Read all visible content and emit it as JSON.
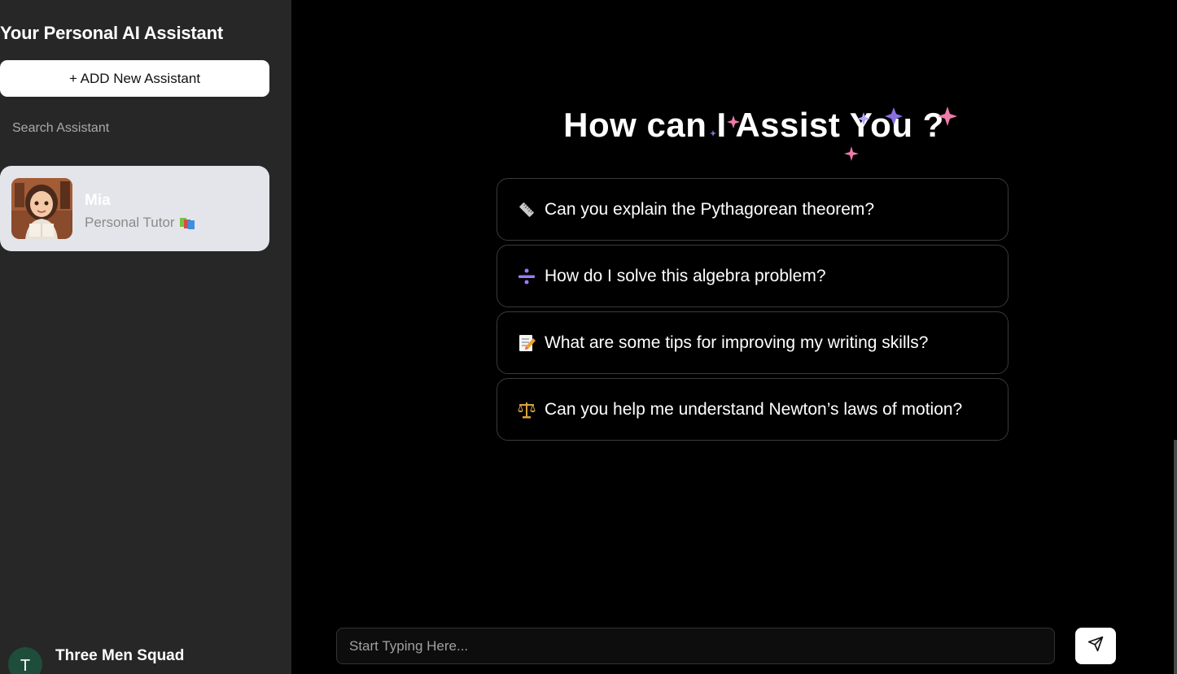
{
  "sidebar": {
    "title": "Your Personal AI Assistant",
    "add_button_label": "+ ADD New Assistant",
    "search_placeholder": "Search Assistant",
    "assistants": [
      {
        "name": "Mia",
        "role": "Personal Tutor"
      }
    ],
    "user": {
      "initial": "T",
      "name": "Three Men Squad"
    }
  },
  "main": {
    "heading": "How can I Assist You ?",
    "prompts": [
      {
        "icon": "ruler-icon",
        "text": "Can you explain the Pythagorean theorem?"
      },
      {
        "icon": "divide-icon",
        "text": "How do I solve this algebra problem?"
      },
      {
        "icon": "memo-icon",
        "text": "What are some tips for improving my writing skills?"
      },
      {
        "icon": "balance-scale-icon",
        "text": "Can you help me understand Newton’s laws of motion?"
      }
    ],
    "chat_placeholder": "Start Typing Here..."
  },
  "colors": {
    "sidebar_bg": "#272727",
    "main_bg": "#000000",
    "card_bg": "#e4e5ea",
    "sparkle_pink": "#f07aa8",
    "sparkle_purple": "#8a6fe0"
  }
}
